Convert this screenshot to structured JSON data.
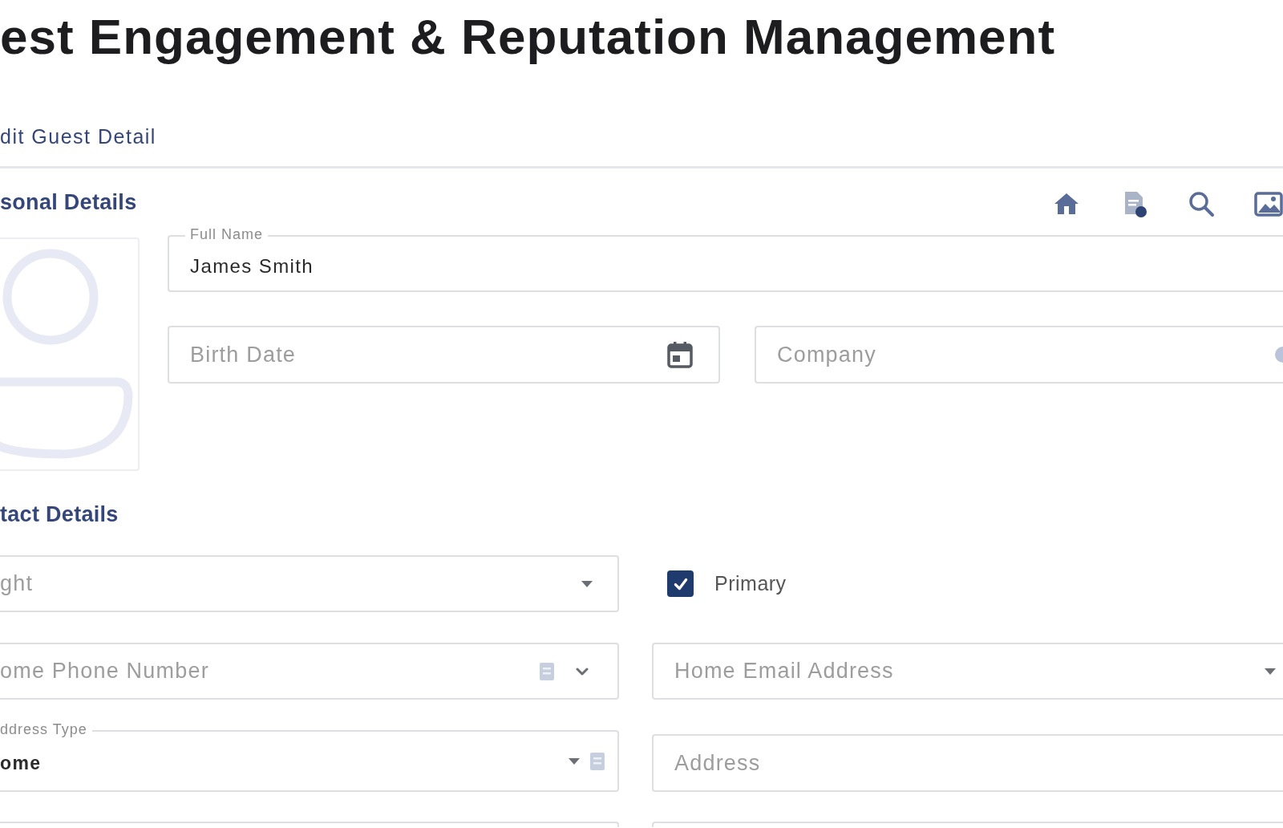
{
  "page_title": "est Engagement & Reputation Management",
  "breadcrumb": "dit Guest Detail",
  "personal_details": {
    "heading": "sonal Details",
    "full_name": {
      "label": "Full Name",
      "value": "James Smith"
    },
    "birth_date": {
      "placeholder": "Birth Date"
    },
    "company": {
      "placeholder": "Company"
    }
  },
  "contact_details": {
    "heading": "tact Details",
    "contact_type": {
      "placeholder": "ght"
    },
    "primary": {
      "label": "Primary",
      "checked": true
    },
    "phone": {
      "placeholder": "ome Phone Number"
    },
    "email": {
      "placeholder": "Home Email Address"
    },
    "address_type": {
      "label": "ddress Type",
      "value": "ome"
    },
    "address": {
      "placeholder": "Address"
    }
  }
}
